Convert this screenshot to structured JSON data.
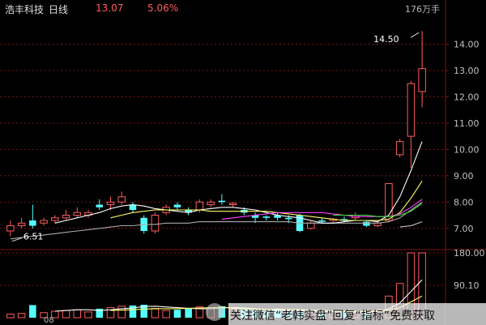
{
  "header": {
    "stock_name": "浩丰科技",
    "period": "日线",
    "price": "13.07",
    "change_pct": "5.06%",
    "volume_label": "176万手"
  },
  "colors": {
    "background": "#000000",
    "up": "#ff5c5c",
    "down": "#54ffff",
    "price_text": "#ff5c5c",
    "axis_text": "#c0c0c0",
    "grid": "#7a1414",
    "ma5": "#ffffff",
    "ma10": "#ffff66",
    "ma20": "#ff44ff",
    "ma30": "#33dd33",
    "ma60": "#cccccc"
  },
  "watermark": {
    "text": "关注微信“老韩实盘”回复“指标”免费获取"
  },
  "chart_data": [
    {
      "type": "candlestick",
      "ylim": [
        6.5,
        15.0
      ],
      "y_ticks": [
        "14.00",
        "13.00",
        "12.00",
        "11.00",
        "10.00",
        "9.00",
        "8.00",
        "7.00"
      ],
      "annotations": [
        {
          "label": "14.50",
          "value": 14.5,
          "note": "high"
        },
        {
          "label": "6.51",
          "value": 6.51,
          "note": "low"
        }
      ],
      "candles": [
        {
          "o": 6.9,
          "c": 7.1,
          "h": 7.3,
          "l": 6.7,
          "up": true
        },
        {
          "o": 7.1,
          "c": 7.2,
          "h": 7.4,
          "l": 7.0,
          "up": true
        },
        {
          "o": 7.3,
          "c": 7.1,
          "h": 7.9,
          "l": 7.0,
          "up": false
        },
        {
          "o": 7.2,
          "c": 7.3,
          "h": 7.4,
          "l": 7.1,
          "up": true
        },
        {
          "o": 7.3,
          "c": 7.4,
          "h": 7.5,
          "l": 7.2,
          "up": true
        },
        {
          "o": 7.4,
          "c": 7.5,
          "h": 7.7,
          "l": 7.3,
          "up": true
        },
        {
          "o": 7.5,
          "c": 7.6,
          "h": 7.8,
          "l": 7.4,
          "up": true
        },
        {
          "o": 7.6,
          "c": 7.5,
          "h": 7.7,
          "l": 7.4,
          "up": true
        },
        {
          "o": 7.9,
          "c": 7.8,
          "h": 8.1,
          "l": 7.7,
          "up": false
        },
        {
          "o": 7.9,
          "c": 8.0,
          "h": 8.2,
          "l": 7.7,
          "up": true
        },
        {
          "o": 8.0,
          "c": 8.2,
          "h": 8.4,
          "l": 7.9,
          "up": true
        },
        {
          "o": 7.9,
          "c": 7.7,
          "h": 8.0,
          "l": 7.6,
          "up": false
        },
        {
          "o": 7.4,
          "c": 6.9,
          "h": 7.5,
          "l": 6.8,
          "up": false
        },
        {
          "o": 6.9,
          "c": 7.5,
          "h": 7.6,
          "l": 6.8,
          "up": true
        },
        {
          "o": 7.6,
          "c": 7.8,
          "h": 7.9,
          "l": 7.5,
          "up": true
        },
        {
          "o": 7.9,
          "c": 7.8,
          "h": 8.0,
          "l": 7.7,
          "up": false
        },
        {
          "o": 7.7,
          "c": 7.6,
          "h": 7.8,
          "l": 7.5,
          "up": false
        },
        {
          "o": 7.7,
          "c": 8.0,
          "h": 8.1,
          "l": 7.6,
          "up": true
        },
        {
          "o": 8.0,
          "c": 7.9,
          "h": 8.1,
          "l": 7.8,
          "up": true
        },
        {
          "o": 8.0,
          "c": 8.05,
          "h": 8.3,
          "l": 7.9,
          "up": false
        },
        {
          "o": 7.9,
          "c": 7.95,
          "h": 8.0,
          "l": 7.8,
          "up": true
        },
        {
          "o": 7.7,
          "c": 7.6,
          "h": 7.8,
          "l": 7.5,
          "up": false
        },
        {
          "o": 7.5,
          "c": 7.4,
          "h": 7.6,
          "l": 7.2,
          "up": false
        },
        {
          "o": 7.4,
          "c": 7.45,
          "h": 7.5,
          "l": 7.3,
          "up": false
        },
        {
          "o": 7.5,
          "c": 7.4,
          "h": 7.6,
          "l": 7.3,
          "up": false
        },
        {
          "o": 7.4,
          "c": 7.35,
          "h": 7.5,
          "l": 7.2,
          "up": false
        },
        {
          "o": 7.5,
          "c": 6.9,
          "h": 7.55,
          "l": 6.85,
          "up": false
        },
        {
          "o": 7.0,
          "c": 7.2,
          "h": 7.3,
          "l": 6.95,
          "up": true
        },
        {
          "o": 7.3,
          "c": 7.25,
          "h": 7.4,
          "l": 7.2,
          "up": false
        },
        {
          "o": 7.3,
          "c": 7.35,
          "h": 7.4,
          "l": 7.2,
          "up": true
        },
        {
          "o": 7.35,
          "c": 7.3,
          "h": 7.45,
          "l": 7.25,
          "up": false
        },
        {
          "o": 7.4,
          "c": 7.5,
          "h": 7.6,
          "l": 7.3,
          "up": true
        },
        {
          "o": 7.25,
          "c": 7.1,
          "h": 7.3,
          "l": 7.05,
          "up": false
        },
        {
          "o": 7.1,
          "c": 7.2,
          "h": 7.3,
          "l": 7.05,
          "up": true
        },
        {
          "o": 7.3,
          "c": 8.7,
          "h": 8.7,
          "l": 7.25,
          "up": true
        },
        {
          "o": 9.8,
          "c": 10.3,
          "h": 10.4,
          "l": 9.7,
          "up": true
        },
        {
          "o": 10.5,
          "c": 12.5,
          "h": 12.6,
          "l": 9.3,
          "up": true
        },
        {
          "o": 12.2,
          "c": 13.07,
          "h": 14.5,
          "l": 11.6,
          "up": true
        }
      ],
      "ma": [
        {
          "name": "MA5",
          "color": "#ffffff",
          "values": [
            null,
            null,
            null,
            null,
            7.2,
            7.3,
            7.4,
            7.5,
            7.6,
            7.75,
            7.85,
            7.9,
            7.85,
            7.75,
            7.7,
            7.65,
            7.6,
            7.7,
            7.75,
            7.8,
            7.8,
            7.75,
            7.7,
            7.6,
            7.5,
            7.45,
            7.4,
            7.3,
            7.2,
            7.2,
            7.25,
            7.3,
            7.3,
            7.25,
            7.5,
            8.2,
            9.2,
            10.3
          ]
        },
        {
          "name": "MA10",
          "color": "#ffff66",
          "values": [
            null,
            null,
            null,
            null,
            null,
            null,
            null,
            null,
            null,
            7.4,
            7.5,
            7.6,
            7.65,
            7.7,
            7.7,
            7.7,
            7.7,
            7.7,
            7.65,
            7.65,
            7.65,
            7.65,
            7.65,
            7.65,
            7.6,
            7.55,
            7.5,
            7.45,
            7.4,
            7.35,
            7.3,
            7.3,
            7.3,
            7.3,
            7.35,
            7.6,
            8.15,
            8.8
          ]
        },
        {
          "name": "MA20",
          "color": "#ff44ff",
          "values": [
            null,
            null,
            null,
            null,
            null,
            null,
            null,
            null,
            null,
            null,
            null,
            null,
            null,
            null,
            null,
            null,
            null,
            null,
            null,
            7.35,
            7.4,
            7.45,
            7.5,
            7.55,
            7.6,
            7.6,
            7.6,
            7.6,
            7.6,
            7.55,
            7.5,
            7.45,
            7.45,
            7.45,
            7.45,
            7.55,
            7.8,
            8.1
          ]
        },
        {
          "name": "MA30",
          "color": "#33dd33",
          "values": [
            null,
            null,
            null,
            null,
            null,
            null,
            null,
            null,
            null,
            null,
            null,
            null,
            null,
            null,
            null,
            null,
            null,
            null,
            null,
            null,
            null,
            null,
            null,
            null,
            null,
            null,
            null,
            null,
            null,
            7.5,
            7.5,
            7.5,
            7.5,
            7.45,
            7.45,
            7.5,
            7.65,
            7.95
          ]
        },
        {
          "name": "MA60",
          "color": "#cccccc",
          "values": [
            null,
            null,
            null,
            null,
            null,
            null,
            null,
            null,
            null,
            null,
            null,
            null,
            null,
            null,
            null,
            null,
            null,
            null,
            null,
            null,
            null,
            null,
            null,
            null,
            null,
            null,
            null,
            null,
            null,
            null,
            null,
            null,
            null,
            null,
            null,
            7.05,
            7.1,
            7.25
          ]
        }
      ],
      "extra_lines": [
        {
          "name": "envelope-low",
          "color": "#aaaaaa",
          "values": [
            6.6,
            6.65,
            6.7,
            6.75,
            6.8,
            6.85,
            6.9,
            6.95,
            7.0,
            7.05,
            7.1,
            7.1,
            7.15,
            7.15,
            7.2,
            7.2,
            7.2,
            7.25,
            7.25,
            7.25,
            7.25,
            7.25,
            7.25,
            7.25,
            7.25,
            7.25,
            7.2,
            7.2,
            7.2,
            7.2,
            7.2,
            7.2,
            7.2,
            7.2,
            7.25,
            7.4,
            7.7,
            8.0
          ]
        }
      ]
    },
    {
      "type": "bar",
      "ylim": [
        0,
        180
      ],
      "y_ticks": [
        "180.00",
        "90.10"
      ],
      "values": [
        10,
        12,
        35,
        14,
        18,
        20,
        22,
        16,
        25,
        28,
        32,
        34,
        36,
        26,
        20,
        22,
        25,
        30,
        28,
        32,
        24,
        22,
        20,
        18,
        20,
        16,
        24,
        15,
        14,
        16,
        18,
        14,
        12,
        22,
        60,
        95,
        180,
        180
      ],
      "up": [
        true,
        true,
        false,
        true,
        true,
        true,
        true,
        true,
        false,
        true,
        true,
        false,
        false,
        true,
        true,
        false,
        false,
        true,
        true,
        false,
        true,
        false,
        false,
        false,
        false,
        false,
        false,
        true,
        false,
        true,
        false,
        true,
        false,
        true,
        true,
        true,
        true,
        true
      ],
      "ma": [
        {
          "name": "VMA5",
          "color": "#ffffff",
          "values": [
            null,
            null,
            null,
            null,
            18,
            20,
            22,
            22,
            20,
            22,
            25,
            27,
            31,
            32,
            30,
            28,
            26,
            25,
            25,
            27,
            28,
            27,
            25,
            23,
            21,
            19,
            20,
            19,
            18,
            17,
            17,
            16,
            15,
            16,
            24,
            41,
            73,
            105
          ]
        },
        {
          "name": "VMA10",
          "color": "#ffff66",
          "values": [
            null,
            null,
            null,
            null,
            null,
            null,
            null,
            null,
            null,
            20,
            21,
            22,
            24,
            25,
            25,
            25,
            26,
            27,
            28,
            29,
            27,
            25,
            24,
            23,
            24,
            23,
            22,
            21,
            20,
            19,
            18,
            18,
            18,
            17,
            20,
            28,
            44,
            60
          ]
        }
      ]
    }
  ],
  "x_axis": {
    "visible_label": "08"
  }
}
